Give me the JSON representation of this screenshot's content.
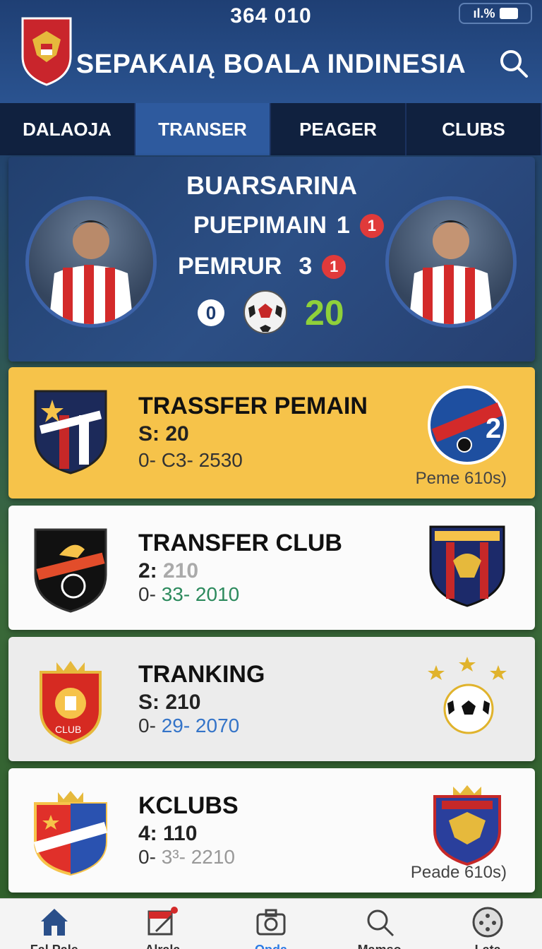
{
  "status": {
    "time": "364 010",
    "signal": "ıl.%"
  },
  "header": {
    "title": "SEPAKAIĄ BOALA INDINESIA"
  },
  "tabs": [
    "DALAOJA",
    "TRANSER",
    "PEAGER",
    "CLUBS"
  ],
  "match": {
    "title": "BUARSARINA",
    "row1_label": "PUEPIMAIN",
    "row1_value": "1",
    "row1_badge": "1",
    "row2_label": "PEMRUR",
    "row2_value": "3",
    "row2_badge": "1",
    "score_left": "0",
    "score_right": "20"
  },
  "cards": [
    {
      "title": "TRASSFER PEMAIN",
      "line2": "S: 20",
      "line3_a": "0- ",
      "line3_b": "C3- 2530",
      "note": "Peme 610s)"
    },
    {
      "title": "TRANSFER CLUB",
      "line2_a": "2:",
      "line2_b": "210",
      "line3_a": "0- ",
      "line3_b": "33- 2010"
    },
    {
      "title": "TRANKING",
      "line2": "S: 210",
      "line3_a": "0- ",
      "line3_b": "29- 2070"
    },
    {
      "title": "KCLUBS",
      "line2": "4: 110",
      "line3_a": "0- ",
      "line3_b": "3³- 2210",
      "note": "Peade 610s)"
    }
  ],
  "nav": [
    "Fal Pale",
    "Alrala",
    "Opda",
    "Mamso",
    "Lata"
  ],
  "colors": {
    "accent": "#2c7be5",
    "header": "#1f3f74",
    "highlight": "#f6c34a",
    "score": "#8fd13a"
  }
}
